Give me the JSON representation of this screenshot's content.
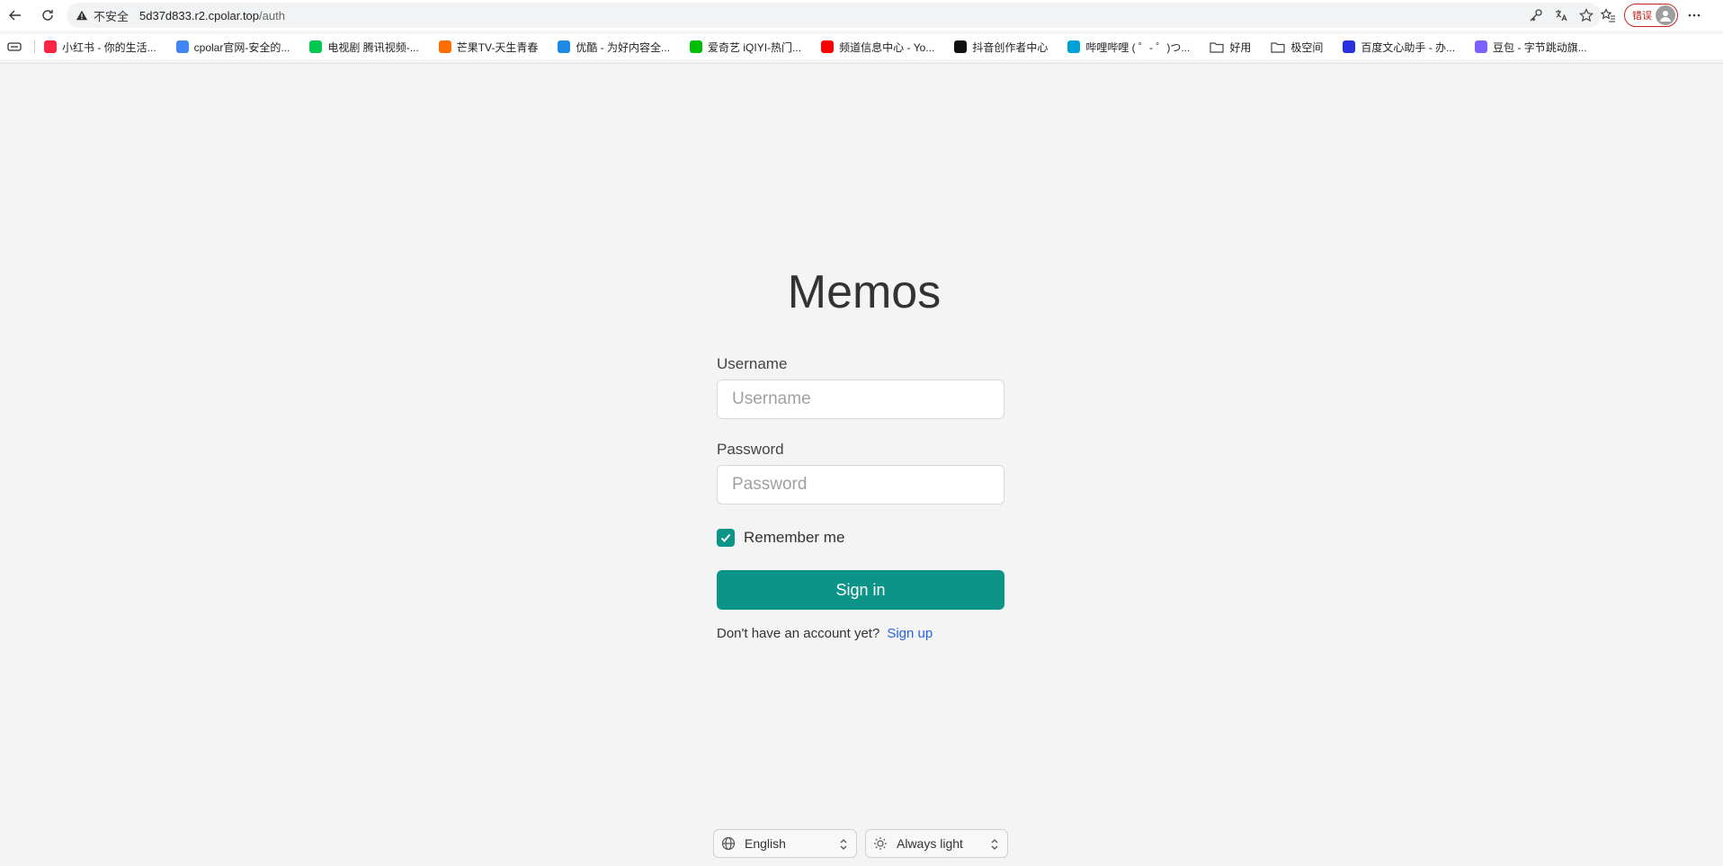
{
  "browser": {
    "insecure_label": "不安全",
    "url_host": "5d37d833.r2.cpolar.top",
    "url_path": "/auth",
    "profile_status": "错误"
  },
  "bookmarks": [
    {
      "label": "小红书 - 你的生活...",
      "color": "#ff2442"
    },
    {
      "label": "cpolar官网-安全的...",
      "color": "#4285f4"
    },
    {
      "label": "电视剧 腾讯视频-...",
      "color": "#00c853"
    },
    {
      "label": "芒果TV-天生青春",
      "color": "#ff6f00"
    },
    {
      "label": "优酷 - 为好内容全...",
      "color": "#1e88e5"
    },
    {
      "label": "爱奇艺 iQIYI-热门...",
      "color": "#00be06"
    },
    {
      "label": "频道信息中心 - Yo...",
      "color": "#ff0000"
    },
    {
      "label": "抖音创作者中心",
      "color": "#111111"
    },
    {
      "label": "哔哩哔哩 ( ゜- ゜)つ...",
      "color": "#00a1d6"
    },
    {
      "label": "好用",
      "color": "folder"
    },
    {
      "label": "极空间",
      "color": "folder"
    },
    {
      "label": "百度文心助手 - 办...",
      "color": "#2932e1"
    },
    {
      "label": "豆包 - 字节跳动旗...",
      "color": "#7b61ff"
    }
  ],
  "main": {
    "title": "Memos",
    "username_label": "Username",
    "username_placeholder": "Username",
    "password_label": "Password",
    "password_placeholder": "Password",
    "remember_label": "Remember me",
    "remember_checked": true,
    "signin_label": "Sign in",
    "no_account_text": "Don't have an account yet?",
    "signup_label": "Sign up"
  },
  "footer": {
    "language": "English",
    "theme": "Always light"
  },
  "colors": {
    "accent": "#0d9488",
    "link": "#2563eb",
    "background": "#f4f4f4"
  }
}
